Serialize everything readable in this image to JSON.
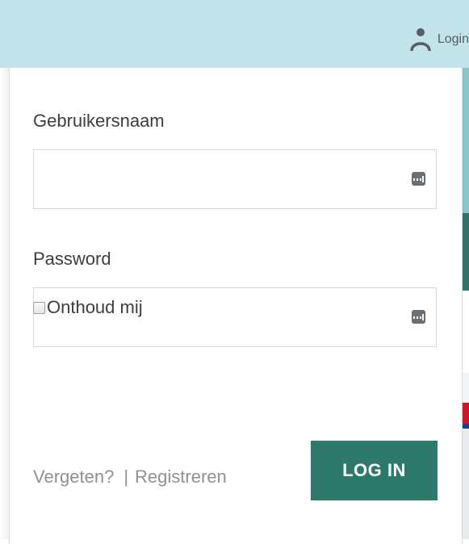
{
  "header": {
    "login_label": "Login"
  },
  "form": {
    "username_label": "Gebruikersnaam",
    "username_value": "",
    "password_label": "Password",
    "password_value": "",
    "remember_label": "Onthoud mij",
    "remember_checked": false,
    "forgot_label": "Vergeten?",
    "separator": "|",
    "register_label": "Registreren",
    "submit_label": "LOG IN"
  },
  "colors": {
    "topbar": "#c1e3e9",
    "button": "#2d7a6c"
  },
  "icons": {
    "user": "user-icon",
    "password_manager": "password-manager-icon"
  }
}
